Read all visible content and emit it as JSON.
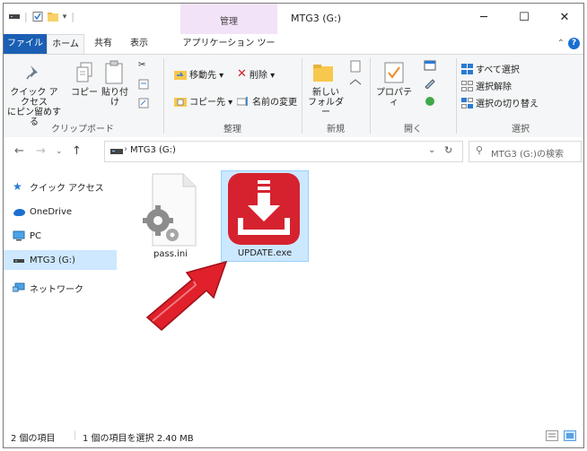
{
  "window": {
    "title": "MTG3 (G:)",
    "context_tab_label": "管理",
    "controls": {
      "minimize": "─",
      "maximize": "☐",
      "close": "✕"
    }
  },
  "ribbon_tabs": {
    "file": "ファイル",
    "home": "ホーム",
    "share": "共有",
    "view": "表示",
    "app_tools": "アプリケーション ツール"
  },
  "ribbon": {
    "clipboard": {
      "group_label": "クリップボード",
      "pin_quick_access": "クイック アクセス\nにピン留めする",
      "copy": "コピー",
      "paste": "貼り付け"
    },
    "organize": {
      "group_label": "整理",
      "move_to": "移動先 ▾",
      "delete": "削除 ▾",
      "copy_to": "コピー先 ▾",
      "rename": "名前の変更"
    },
    "new": {
      "group_label": "新規",
      "new_folder": "新しい\nフォルダー"
    },
    "open": {
      "group_label": "開く",
      "properties": "プロパティ"
    },
    "select": {
      "group_label": "選択",
      "select_all": "すべて選択",
      "select_none": "選択解除",
      "invert_selection": "選択の切り替え"
    }
  },
  "address": {
    "path": "MTG3 (G:)",
    "search_placeholder": "MTG3 (G:)の検索"
  },
  "nav_pane": {
    "items": [
      {
        "label": "クイック アクセス"
      },
      {
        "label": "OneDrive"
      },
      {
        "label": "PC"
      },
      {
        "label": "MTG3 (G:)"
      },
      {
        "label": "ネットワーク"
      }
    ]
  },
  "files": [
    {
      "name": "pass.ini"
    },
    {
      "name": "UPDATE.exe"
    }
  ],
  "status_bar": {
    "item_count": "2 個の項目",
    "selection": "1 個の項目を選択  2.40 MB"
  },
  "colors": {
    "file_tab": "#1a5fb4",
    "context_tab": "#f3e3f8",
    "selection": "#cce8ff",
    "update_icon": "#d6222f",
    "arrow": "#e0202a"
  }
}
